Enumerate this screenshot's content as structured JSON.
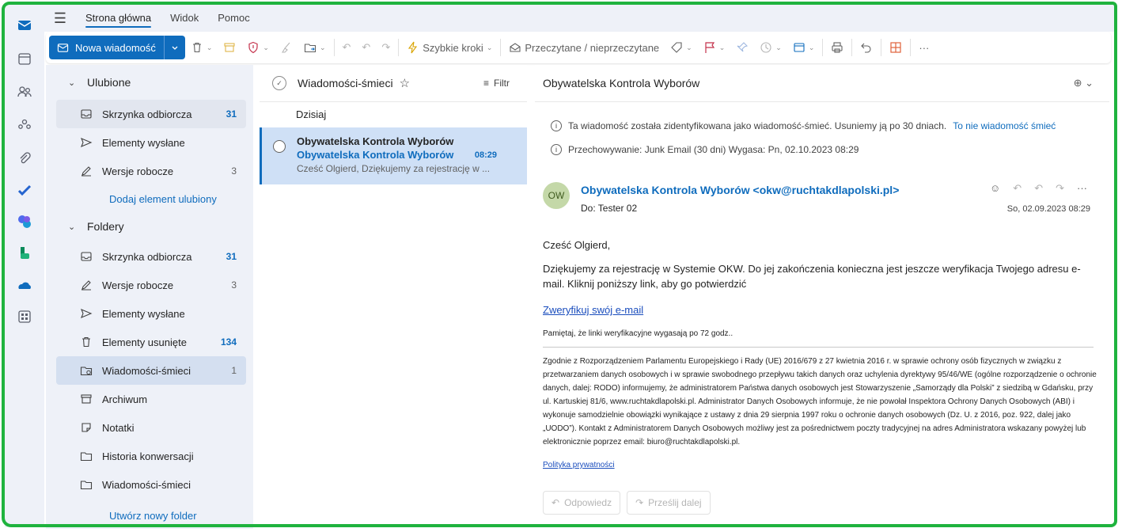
{
  "tabs": [
    "Strona główna",
    "Widok",
    "Pomoc"
  ],
  "ribbon": {
    "new_message": "Nowa wiadomość",
    "quick_steps": "Szybkie kroki",
    "read_unread": "Przeczytane / nieprzeczytane"
  },
  "folders": {
    "favorites_title": "Ulubione",
    "favorites": [
      {
        "label": "Skrzynka odbiorcza",
        "count": "31"
      },
      {
        "label": "Elementy wysłane",
        "count": ""
      },
      {
        "label": "Wersje robocze",
        "count": "3"
      }
    ],
    "add_favorite": "Dodaj element ulubiony",
    "folders_title": "Foldery",
    "items": [
      {
        "label": "Skrzynka odbiorcza",
        "count": "31"
      },
      {
        "label": "Wersje robocze",
        "count": "3"
      },
      {
        "label": "Elementy wysłane",
        "count": ""
      },
      {
        "label": "Elementy usunięte",
        "count": "134"
      },
      {
        "label": "Wiadomości-śmieci",
        "count": "1"
      },
      {
        "label": "Archiwum",
        "count": ""
      },
      {
        "label": "Notatki",
        "count": ""
      },
      {
        "label": "Historia konwersacji",
        "count": ""
      },
      {
        "label": "Wiadomości-śmieci",
        "count": ""
      }
    ],
    "new_folder": "Utwórz nowy folder"
  },
  "list": {
    "title": "Wiadomości-śmieci",
    "filter": "Filtr",
    "day": "Dzisiaj",
    "message": {
      "from": "Obywatelska Kontrola Wyborów",
      "subject": "Obywatelska Kontrola Wyborów",
      "time": "08:29",
      "preview": "Cześć Olgierd, Dziękujemy za rejestrację w ..."
    }
  },
  "reading": {
    "subject": "Obywatelska Kontrola Wyborów",
    "junk_info": "Ta wiadomość została zidentyfikowana jako wiadomość-śmieć. Usuniemy ją po 30 dniach.",
    "not_junk": "To nie wiadomość śmieć",
    "retention": "Przechowywanie: Junk Email (30 dni) Wygasa: Pn, 02.10.2023 08:29",
    "avatar": "OW",
    "sender": "Obywatelska Kontrola Wyborów <okw@ruchtakdlapolski.pl>",
    "to": "Do:  Tester 02",
    "date": "So, 02.09.2023 08:29",
    "greeting": "Cześć Olgierd,",
    "paragraph": "Dziękujemy za rejestrację w Systemie OKW. Do jej zakończenia konieczna jest jeszcze weryfikacja Twojego adresu e-mail. Kliknij poniższy link, aby go potwierdzić",
    "verify_link": "Zweryfikuj swój e-mail",
    "note": "Pamiętaj, że linki weryfikacyjne wygasają po 72 godz..",
    "legal": "Zgodnie z Rozporządzeniem Parlamentu Europejskiego i Rady (UE) 2016/679 z 27 kwietnia 2016 r. w sprawie ochrony osób fizycznych w związku z przetwarzaniem danych osobowych i w sprawie swobodnego przepływu takich danych oraz uchylenia dyrektywy 95/46/WE (ogólne rozporządzenie o ochronie danych, dalej: RODO) informujemy, że administratorem Państwa danych osobowych jest Stowarzyszenie „Samorządy dla Polski” z siedzibą w Gdańsku, przy ul. Kartuskiej 81/6, www.ruchtakdlapolski.pl. Administrator Danych Osobowych informuje, że nie powołał Inspektora Ochrony Danych Osobowych (ABI) i wykonuje samodzielnie obowiązki wynikające z ustawy z dnia 29 sierpnia 1997 roku o ochronie danych osobowych (Dz. U. z 2016, poz. 922, dalej jako „UODO”). Kontakt z Administratorem Danych Osobowych możliwy jest za pośrednictwem poczty tradycyjnej na adres Administratora wskazany powyżej lub elektronicznie poprzez email: biuro@ruchtakdlapolski.pl.",
    "privacy_link": "Polityka prywatności",
    "reply": "Odpowiedz",
    "forward": "Prześlij dalej"
  },
  "colors": {
    "accent": "#0f6cbd",
    "border": "#1fb33e",
    "selected": "#cfe0f6"
  }
}
